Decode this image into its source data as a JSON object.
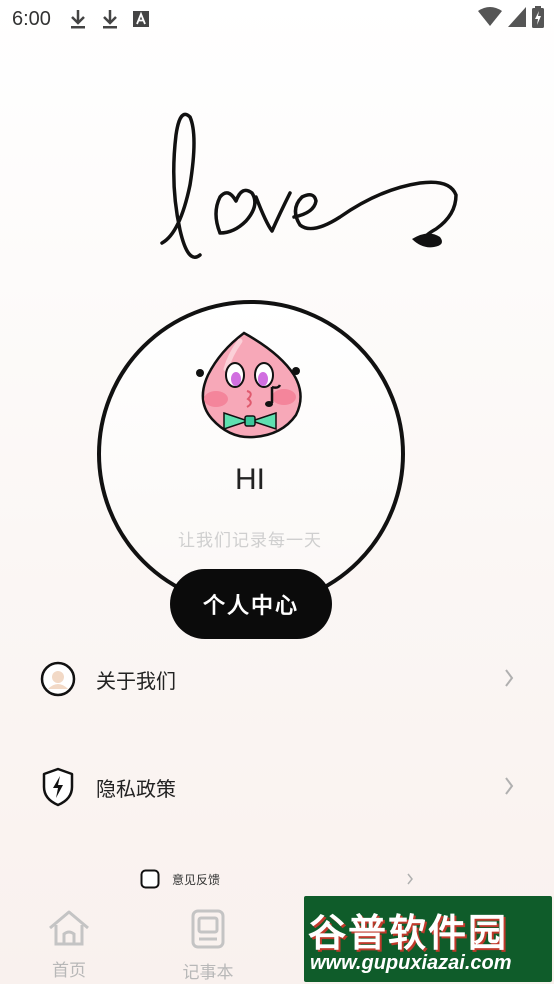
{
  "status_bar": {
    "time": "6:00",
    "icons_left": [
      "download-icon",
      "download-icon",
      "font-a-icon"
    ],
    "icons_right": [
      "wifi-icon",
      "signal-icon",
      "battery-charging-icon"
    ]
  },
  "hero": {
    "art": "love"
  },
  "profile": {
    "greeting": "HI",
    "tagline": "让我们记录每一天",
    "center_button": "个人中心"
  },
  "menu": [
    {
      "label": "关于我们",
      "icon": "about-avatar-icon"
    },
    {
      "label": "隐私政策",
      "icon": "privacy-shield-icon"
    }
  ],
  "feedback": {
    "label": "意见反馈",
    "icon": "feedback-checkbox-icon"
  },
  "bottom_nav": [
    {
      "label": "首页",
      "icon": "home-icon"
    },
    {
      "label": "记事本",
      "icon": "notepad-icon"
    }
  ],
  "watermark": {
    "logo_text": "谷普软件园",
    "url": "www.gupuxiazai.com"
  },
  "colors": {
    "button_bg": "#0b0b0b",
    "tagline": "#cfcfcf",
    "nav_inactive": "#b8b8b8",
    "peach": "#f7a8b8",
    "bowtie": "#5fe0b0"
  }
}
